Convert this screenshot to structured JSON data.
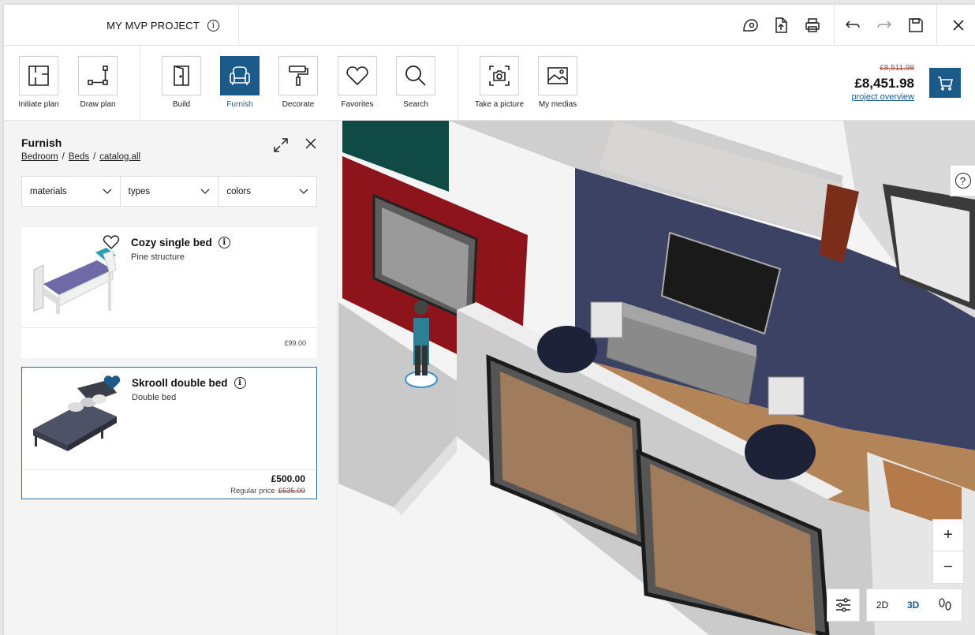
{
  "project": {
    "title": "MY MVP PROJECT"
  },
  "toolbar": {
    "tools": [
      {
        "label": "Initiate plan",
        "icon": "plan-icon",
        "active": false
      },
      {
        "label": "Draw plan",
        "icon": "draw-icon",
        "active": false
      },
      {
        "label": "Build",
        "icon": "door-icon",
        "active": false
      },
      {
        "label": "Furnish",
        "icon": "armchair-icon",
        "active": true
      },
      {
        "label": "Decorate",
        "icon": "paint-roller-icon",
        "active": false
      },
      {
        "label": "Favorites",
        "icon": "heart-icon",
        "active": false
      },
      {
        "label": "Search",
        "icon": "search-icon",
        "active": false
      },
      {
        "label": "Take a picture",
        "icon": "camera-icon",
        "active": false
      },
      {
        "label": "My medias",
        "icon": "image-icon",
        "active": false
      }
    ],
    "old_price": "£8,511.98",
    "price": "£8,451.98",
    "overview_link": "project overview"
  },
  "panel": {
    "title": "Furnish",
    "breadcrumb": [
      "Bedroom",
      "Beds",
      "catalog.all"
    ],
    "filters": [
      "materials",
      "types",
      "colors"
    ],
    "products": [
      {
        "name": "Cozy single bed",
        "description": "Pine structure",
        "price": "£99.00",
        "selected": false
      },
      {
        "name": "Skrooll double bed",
        "description": "Double bed",
        "price": "£500.00",
        "regular_label": "Regular price",
        "regular_price": "£535.00",
        "selected": true
      }
    ]
  },
  "viewport": {
    "zoom_in": "+",
    "zoom_out": "−",
    "views": [
      "2D",
      "3D"
    ],
    "active_view": "3D"
  },
  "colors": {
    "accent": "#1c5a8a",
    "wall_blue": "#3c4263",
    "wall_red": "#8c141a",
    "wall_green": "#0f4a45",
    "floor": "#b48459"
  }
}
